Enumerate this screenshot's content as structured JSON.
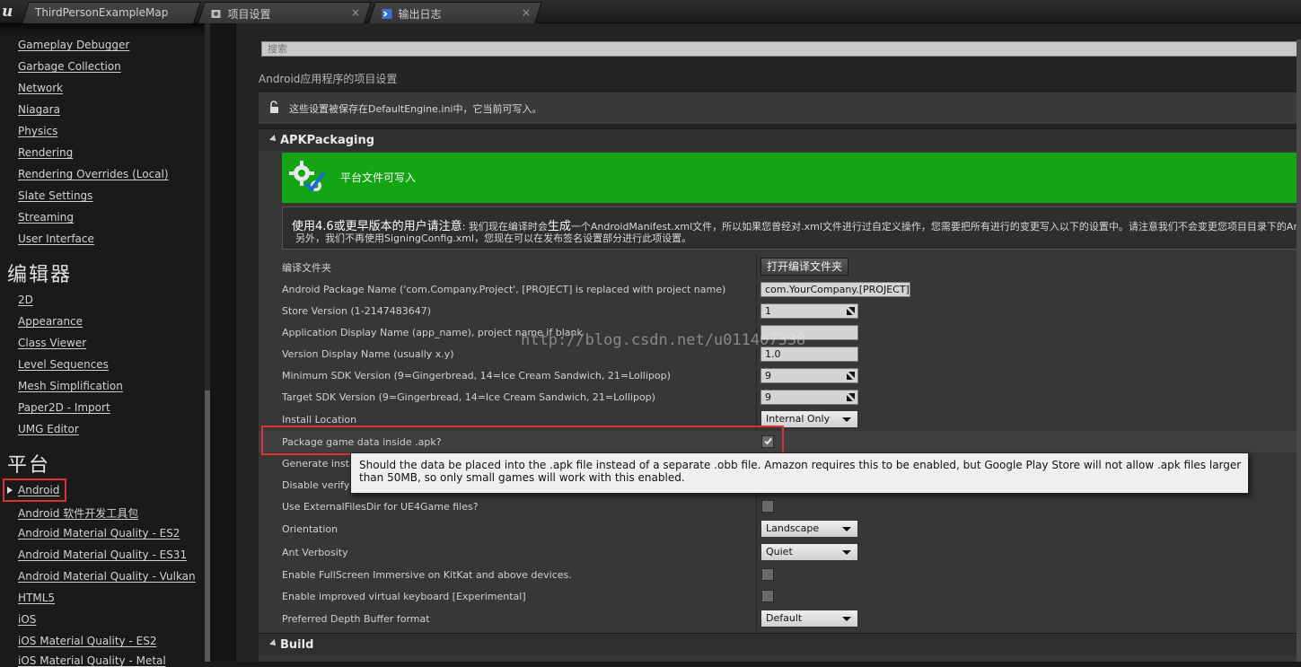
{
  "tabs": [
    {
      "label": "ThirdPersonExampleMap",
      "icon": "level-icon"
    },
    {
      "label": "项目设置",
      "icon": "settings-icon",
      "close": "×"
    },
    {
      "label": "输出日志",
      "icon": "log-icon",
      "close": "×"
    }
  ],
  "sidebar": {
    "items_top": [
      "Gameplay Debugger",
      "Garbage Collection",
      "Network",
      "Niagara",
      "Physics",
      "Rendering",
      "Rendering Overrides (Local)",
      "Slate Settings",
      "Streaming",
      "User Interface"
    ],
    "heading_editor": "编辑器",
    "items_editor": [
      "2D",
      "Appearance",
      "Class Viewer",
      "Level Sequences",
      "Mesh Simplification",
      "Paper2D - Import",
      "UMG Editor"
    ],
    "heading_platform": "平台",
    "items_platform": [
      "Android",
      "Android 软件开发工具包",
      "Android Material Quality - ES2",
      "Android Material Quality - ES31",
      "Android Material Quality - Vulkan",
      "HTML5",
      "iOS",
      "iOS Material Quality - ES2",
      "iOS Material Quality - Metal"
    ]
  },
  "main": {
    "search_placeholder": "搜索",
    "subtitle": "Android应用程序的项目设置",
    "info_text": "这些设置被保存在DefaultEngine.ini中，它当前可写入。",
    "section_apk": "APKPackaging",
    "section_build": "Build",
    "banner_text": "平台文件可写入",
    "notice_bold": "使用4.6或更早版本的用户请注意",
    "notice_line1_mid": ": 我们现在编译时会",
    "notice_bold2": "生成",
    "notice_line1_rest": "一个AndroidManifest.xml文件，所以如果您曾经对.xml文件进行过自定义操作，您需要把所有进行的变更写入以下的设置中。请注意我们不会变更您项目目录下的Androi",
    "notice_line2": "另外，我们不再使用SigningConfig.xml，您现在可以在发布签名设置部分进行此项设置。",
    "properties": {
      "build_folder_label": "编译文件夹",
      "build_folder_button": "打开编译文件夹",
      "package_name_label": "Android Package Name ('com.Company.Project', [PROJECT] is replaced with project name)",
      "package_name_value": "com.YourCompany.[PROJECT]",
      "store_version_label": "Store Version (1-2147483647)",
      "store_version_value": "1",
      "app_display_name_label": "Application Display Name (app_name), project name if blank",
      "app_display_name_value": "",
      "version_display_label": "Version Display Name (usually x.y)",
      "version_display_value": "1.0",
      "min_sdk_label": "Minimum SDK Version (9=Gingerbread, 14=Ice Cream Sandwich, 21=Lollipop)",
      "min_sdk_value": "9",
      "target_sdk_label": "Target SDK Version (9=Gingerbread, 14=Ice Cream Sandwich, 21=Lollipop)",
      "target_sdk_value": "9",
      "install_location_label": "Install Location",
      "install_location_value": "Internal Only",
      "package_inside_apk_label": "Package game data inside .apk?",
      "package_inside_apk_checked": true,
      "generate_install_label": "Generate instal",
      "disable_verify_label": "Disable verify O",
      "external_files_label": "Use ExternalFilesDir for UE4Game files?",
      "external_files_checked": false,
      "orientation_label": "Orientation",
      "orientation_value": "Landscape",
      "ant_verbosity_label": "Ant Verbosity",
      "ant_verbosity_value": "Quiet",
      "fullscreen_label": "Enable FullScreen Immersive on KitKat and above devices.",
      "fullscreen_checked": false,
      "keyboard_label": "Enable improved virtual keyboard [Experimental]",
      "keyboard_checked": false,
      "depth_buffer_label": "Preferred Depth Buffer format",
      "depth_buffer_value": "Default"
    },
    "tooltip": "Should the data be placed into the .apk file instead of a separate .obb file. Amazon requires this to be enabled, but Google Play Store will not allow .apk files larger than 50MB, so only small games will work with this enabled.",
    "watermark": "http://blog.csdn.net/u011407338"
  },
  "colors": {
    "banner_green": "#13a513",
    "highlight_red": "#e03030",
    "panel_bg": "#373737"
  }
}
